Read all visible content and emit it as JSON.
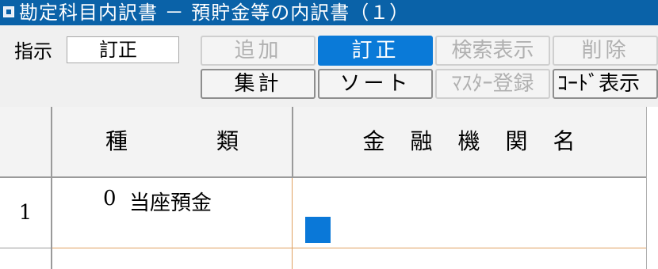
{
  "window": {
    "title": "勘定科目内訳書 － 預貯金等の内訳書（１）"
  },
  "mode": {
    "label": "指示",
    "value": "訂正"
  },
  "toolbar": {
    "row1": [
      {
        "label": "追加",
        "state": "disabled"
      },
      {
        "label": "訂正",
        "state": "active"
      },
      {
        "label": "検索表示",
        "state": "disabled"
      },
      {
        "label": "削除",
        "state": "disabled"
      }
    ],
    "row2": [
      {
        "label": "集計",
        "state": "enabled"
      },
      {
        "label": "ソート",
        "state": "enabled"
      },
      {
        "label": "ﾏｽﾀｰ登録",
        "state": "disabled"
      },
      {
        "label": "ｺｰﾄﾞ表示",
        "state": "enabled"
      }
    ]
  },
  "grid": {
    "columns": [
      {
        "label": "種　　　　類"
      },
      {
        "label": "金　融　機　関　名"
      }
    ],
    "rows": [
      {
        "number": "1",
        "type_code": "0",
        "type_name": "当座預金",
        "bank_name": ""
      }
    ]
  },
  "colors": {
    "title_bar": "#0a62a8",
    "active_button": "#0a7ad8",
    "grid_line": "#e0a060"
  }
}
